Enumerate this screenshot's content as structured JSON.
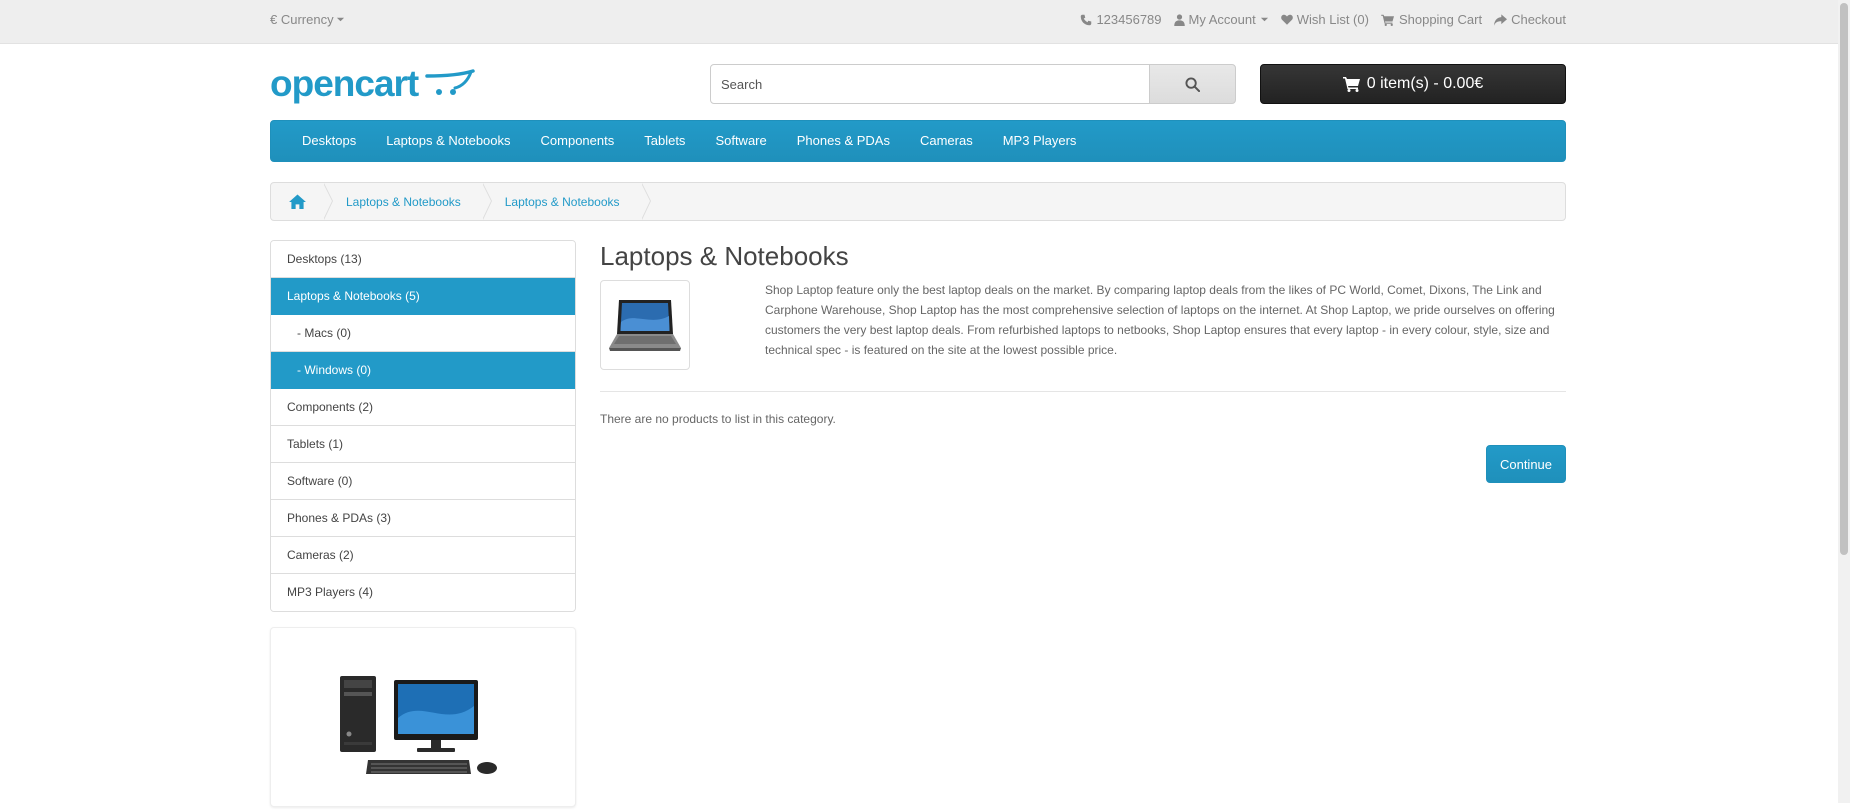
{
  "topbar": {
    "currency_label": "€ Currency",
    "phone": "123456789",
    "my_account": "My Account",
    "wish_list": "Wish List (0)",
    "shopping_cart": "Shopping Cart",
    "checkout": "Checkout"
  },
  "header": {
    "logo_text": "opencart",
    "search_placeholder": "Search",
    "cart_label": "0 item(s) - 0.00€"
  },
  "menu": {
    "items": [
      "Desktops",
      "Laptops & Notebooks",
      "Components",
      "Tablets",
      "Software",
      "Phones & PDAs",
      "Cameras",
      "MP3 Players"
    ]
  },
  "breadcrumb": {
    "items": [
      "Laptops & Notebooks",
      "Laptops & Notebooks"
    ]
  },
  "sidebar": {
    "items": [
      {
        "label": "Desktops (13)",
        "active": false
      },
      {
        "label": "Laptops & Notebooks (5)",
        "active": true
      },
      {
        "label": "- Macs (0)",
        "active": false
      },
      {
        "label": "- Windows (0)",
        "active": true
      },
      {
        "label": "Components (2)",
        "active": false
      },
      {
        "label": "Tablets (1)",
        "active": false
      },
      {
        "label": "Software (0)",
        "active": false
      },
      {
        "label": "Phones & PDAs (3)",
        "active": false
      },
      {
        "label": "Cameras (2)",
        "active": false
      },
      {
        "label": "MP3 Players (4)",
        "active": false
      }
    ]
  },
  "content": {
    "title": "Laptops & Notebooks",
    "description": "Shop Laptop feature only the best laptop deals on the market. By comparing laptop deals from the likes of PC World, Comet, Dixons, The Link and Carphone Warehouse, Shop Laptop has the most comprehensive selection of laptops on the internet. At Shop Laptop, we pride ourselves on offering customers the very best laptop deals. From refurbished laptops to netbooks, Shop Laptop ensures that every laptop - in every colour, style, size and technical spec - is featured on the site at the lowest possible price.",
    "empty_message": "There are no products to list in this category.",
    "continue_label": "Continue"
  },
  "colors": {
    "accent": "#229ac8",
    "cart_button": "#2b2b2b",
    "topbar": "#eeeeee"
  }
}
